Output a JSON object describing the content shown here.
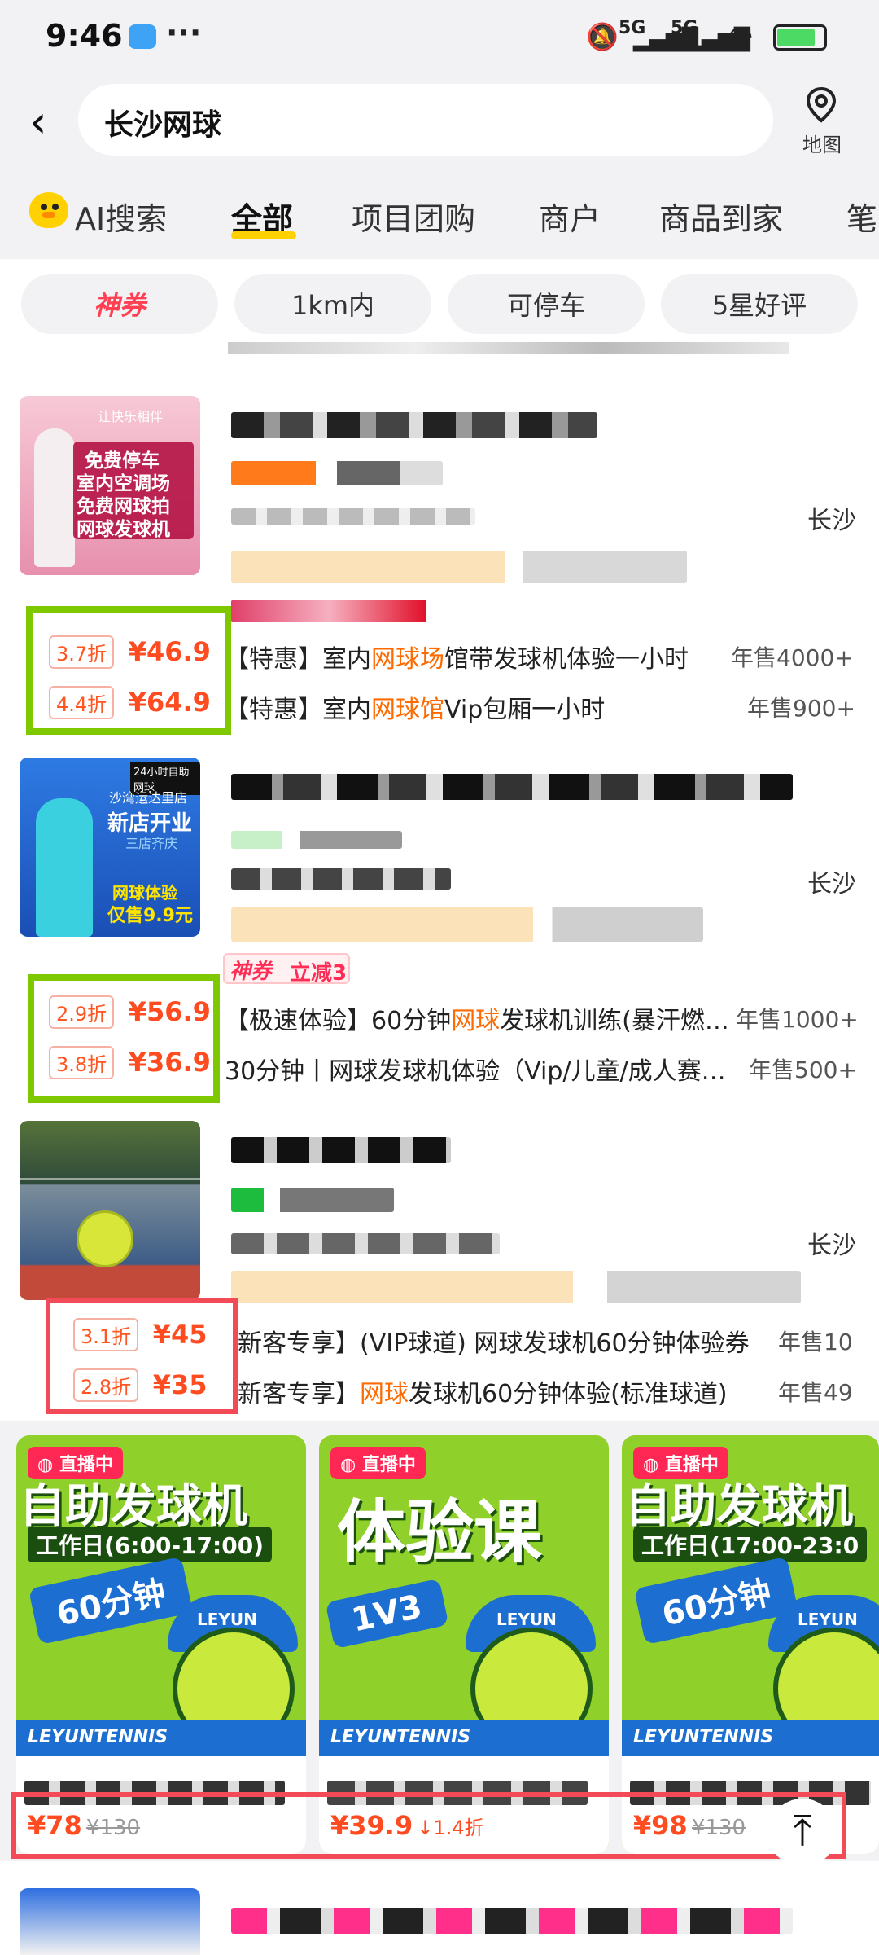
{
  "status_bar": {
    "time": "9:46",
    "signal1": "5G",
    "signal2": "5G"
  },
  "search": {
    "query": "长沙网球",
    "map_label": "地图"
  },
  "tabs": [
    {
      "label": "AI搜索"
    },
    {
      "label": "全部"
    },
    {
      "label": "项目团购"
    },
    {
      "label": "商户"
    },
    {
      "label": "商品到家"
    },
    {
      "label": "笔"
    }
  ],
  "filters": [
    {
      "label": "神券"
    },
    {
      "label": "1km内"
    },
    {
      "label": "可停车"
    },
    {
      "label": "5星好评"
    }
  ],
  "listings": [
    {
      "thumb_lines": [
        "让快乐相伴",
        "免费停车",
        "室内空调场",
        "免费网球拍",
        "网球发球机"
      ],
      "city": "长沙",
      "deals": [
        {
          "discount": "3.7折",
          "price": "46.9",
          "pre": "【特惠】室内",
          "kw": "网球场",
          "post": "馆带发球机体验一小时",
          "sold": "年售4000+"
        },
        {
          "discount": "4.4折",
          "price": "64.9",
          "pre": "【特惠】室内",
          "kw": "网球馆",
          "post": "Vip包厢一小时",
          "sold": "年售900+"
        }
      ]
    },
    {
      "thumb_lines": [
        "24小时自助网球",
        "沙湾运达里店",
        "新店开业",
        "三店齐庆",
        "网球体验",
        "仅售9.9元"
      ],
      "city": "长沙",
      "coupon_tag": "神券",
      "coupon_off": "立减3",
      "deals": [
        {
          "discount": "2.9折",
          "price": "56.9",
          "pre": "【极速体验】60分钟",
          "kw": "网球",
          "post": "发球机训练(暴汗燃…",
          "sold": "年售1000+"
        },
        {
          "discount": "3.8折",
          "price": "36.9",
          "pre": "30分钟丨网球发球机体验（Vip/儿童/成人赛…",
          "kw": "",
          "post": "",
          "sold": "年售500+"
        }
      ]
    },
    {
      "city": "长沙",
      "deals": [
        {
          "discount": "3.1折",
          "price": "45",
          "pre": "新客专享】(VIP球道) 网球发球机60分钟体验券",
          "kw": "",
          "post": "",
          "sold": "年售10"
        },
        {
          "discount": "2.8折",
          "price": "35",
          "pre": "新客专享】",
          "kw": "网球",
          "post": "发球机60分钟体验(标准球道)",
          "sold": "年售49"
        }
      ]
    }
  ],
  "video_cards": [
    {
      "live": "直播中",
      "title": "自助发球机",
      "sub": "工作日(6:00-17:00)",
      "arrow": "60分钟",
      "brand": "LEYUN",
      "band": "LEYUNTENNIS",
      "price": "78",
      "orig": "130",
      "drop": ""
    },
    {
      "live": "直播中",
      "title": "体验课",
      "sub": "",
      "arrow": "1V3",
      "brand": "LEYUN",
      "band": "LEYUNTENNIS",
      "price": "39.9",
      "orig": "",
      "drop": "1.4折"
    },
    {
      "live": "直播中",
      "title": "自助发球机",
      "sub": "工作日(17:00-23:0",
      "arrow": "60分钟",
      "brand": "LEYUN",
      "band": "LEYUNTENNIS",
      "price": "98",
      "orig": "130",
      "drop": ""
    }
  ],
  "currency": "¥",
  "colors": {
    "accent": "#ff4b20",
    "keyword": "#ff6a00",
    "highlight_green": "#7ec800",
    "highlight_red": "#f24b57",
    "tab_underline": "#ffd100"
  }
}
